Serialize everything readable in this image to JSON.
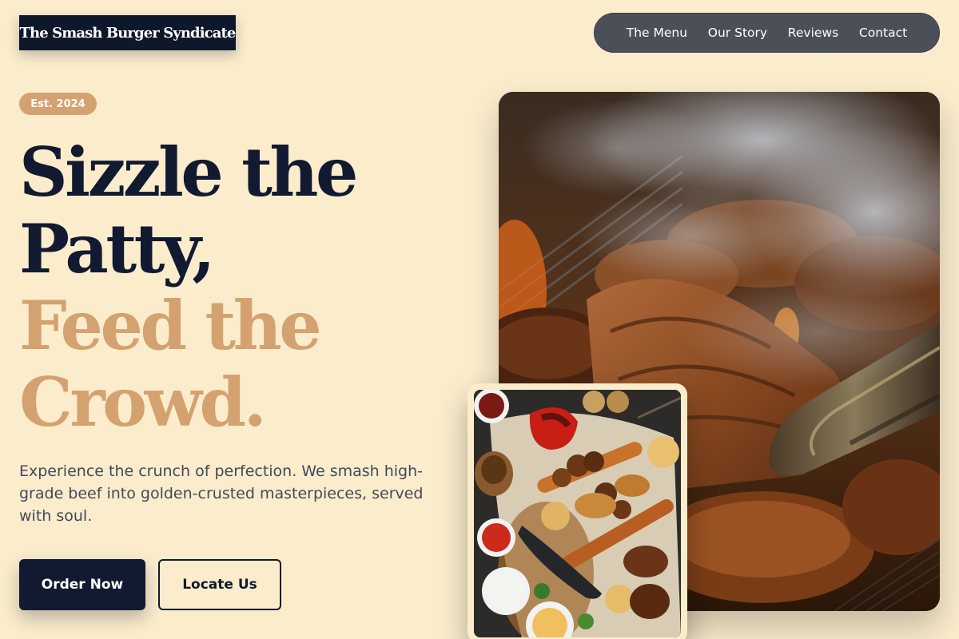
{
  "header": {
    "logo_text": "The Smash Burger Syndicate",
    "nav": [
      {
        "label": "The Menu"
      },
      {
        "label": "Our Story"
      },
      {
        "label": "Reviews"
      },
      {
        "label": "Contact"
      }
    ]
  },
  "hero": {
    "badge": "Est. 2024",
    "headline": {
      "line1": "Sizzle the",
      "line2": "Patty,",
      "line3": "Feed the",
      "line4": "Crowd."
    },
    "description": "Experience the crunch of perfection. We smash high-grade beef into golden-crusted masterpieces, served with soul.",
    "primary_cta": "Order Now",
    "secondary_cta": "Locate Us"
  },
  "images": {
    "main_photo": "grilled-steak-with-tongs-photo",
    "secondary_photo": "kebab-platter-photo"
  },
  "colors": {
    "background": "#fbeccc",
    "navy": "#111a30",
    "accent_tan": "#d4a270",
    "nav_bg": "#4b5058"
  }
}
